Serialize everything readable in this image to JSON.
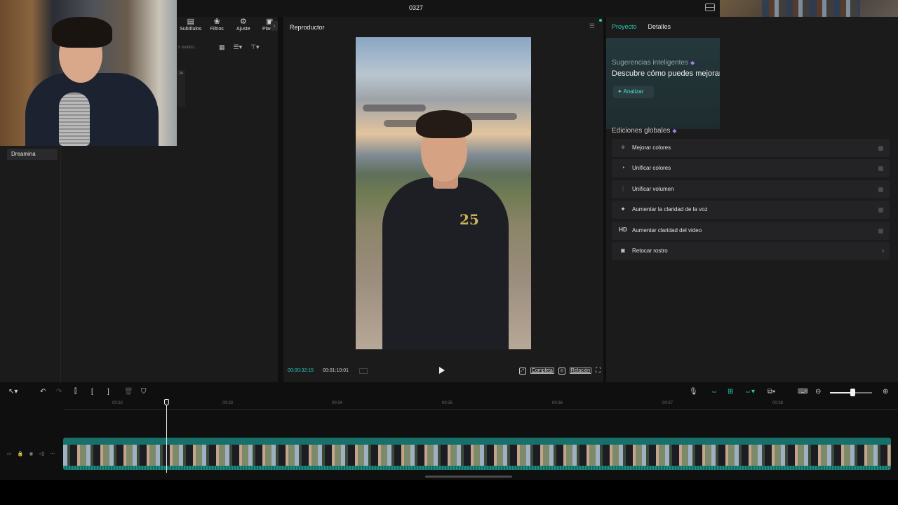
{
  "window": {
    "title": "0327"
  },
  "toolbar_tabs": [
    {
      "label": "Subtítulos",
      "icon": "subtitles-icon",
      "glyph": "▤"
    },
    {
      "label": "Filtros",
      "icon": "filters-icon",
      "glyph": "❀"
    },
    {
      "label": "Ajuste",
      "icon": "adjust-icon",
      "glyph": "⚙"
    },
    {
      "label": "Plantill",
      "icon": "templates-icon",
      "glyph": "▣"
    }
  ],
  "media": {
    "search_placeholder": "s multim...",
    "side_badge": "24",
    "sidebar_item": "Dreamina"
  },
  "player": {
    "title": "Reproductor",
    "current_time": "00:00:32:15",
    "total_time": "00:01:10:01",
    "full_label": "Completa",
    "ratio_label": "Relación"
  },
  "right_panel": {
    "tabs": [
      "Proyecto",
      "Detalles"
    ],
    "suggestions_title": "Sugerencias inteligentes",
    "suggestions_desc": "Descubre cómo puedes mejorar",
    "analyze_label": "Analizar",
    "globals_title": "Ediciones globales",
    "edits": [
      {
        "label": "Mejorar colores",
        "icon": "enhance-colors-icon",
        "glyph": "✧",
        "control": "toggle"
      },
      {
        "label": "Unificar colores",
        "icon": "unify-colors-icon",
        "glyph": "◔",
        "control": "toggle"
      },
      {
        "label": "Unificar volumen",
        "icon": "unify-volume-icon",
        "glyph": "⫶",
        "control": "toggle"
      },
      {
        "label": "Aumentar la claridad de la voz",
        "icon": "voice-clarity-icon",
        "glyph": "✦",
        "control": "toggle"
      },
      {
        "label": "Aumentar claridad del video",
        "icon": "hd-icon",
        "glyph": "HD",
        "control": "toggle"
      },
      {
        "label": "Retocar rostro",
        "icon": "face-retouch-icon",
        "glyph": "◙",
        "control": "arrow"
      }
    ]
  },
  "timeline": {
    "ticks": [
      "00:32",
      "00:33",
      "00:34",
      "00:35",
      "00:36",
      "00:37",
      "00:38"
    ],
    "colors": {
      "accent": "#2dc9b8",
      "clip": "#17706a"
    }
  }
}
